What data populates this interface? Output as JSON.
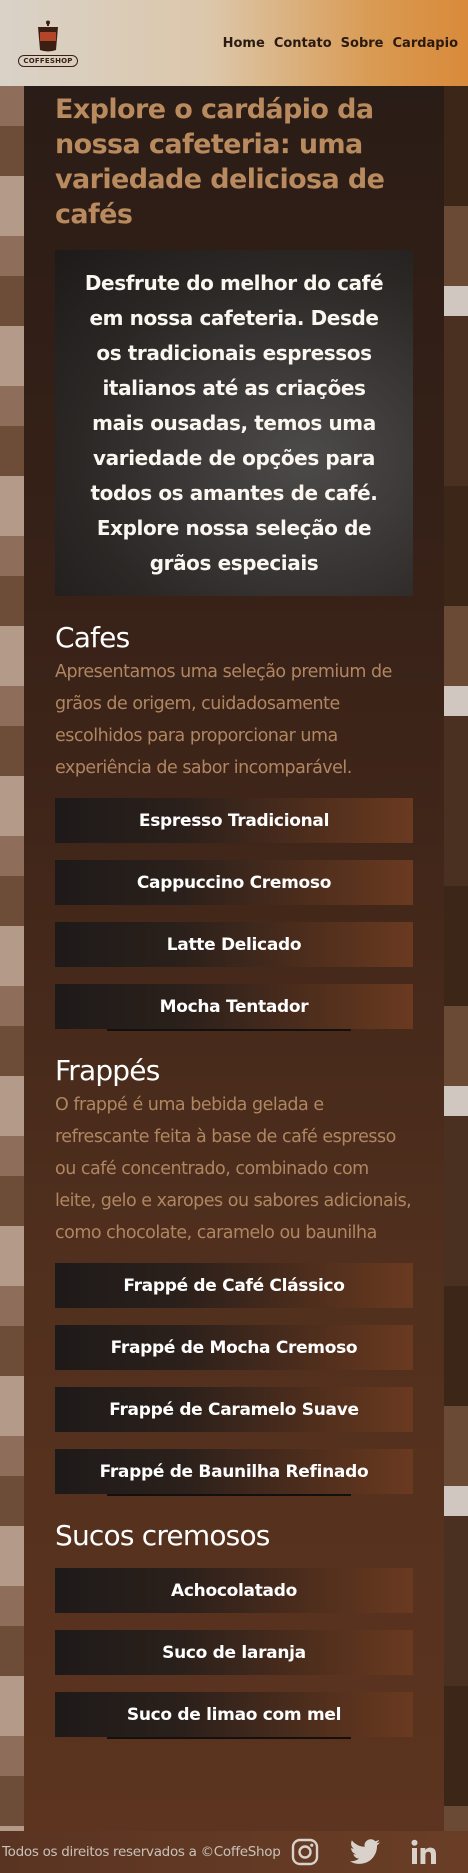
{
  "header": {
    "logo_text": "COFFESHOP",
    "nav": [
      "Home",
      "Contato",
      "Sobre",
      "Cardapio"
    ]
  },
  "hero": {
    "title": "Explore o cardápio da nossa cafeteria: uma variedade deliciosa de cafés",
    "intro": "Desfrute do melhor do café em nossa cafeteria. Desde os tradicionais espressos italianos até as criações mais ousadas, temos uma variedade de opções para todos os amantes de café. Explore nossa seleção de grãos especiais"
  },
  "sections": [
    {
      "title": "Cafes",
      "description": "Apresentamos uma seleção premium de grãos de origem, cuidadosamente escolhidos para proporcionar uma experiência de sabor incomparável.",
      "items": [
        "Espresso Tradicional",
        "Cappuccino Cremoso",
        "Latte Delicado",
        "Mocha Tentador"
      ]
    },
    {
      "title": "Frappés",
      "description": "O frappé é uma bebida gelada e refrescante feita à base de café espresso ou café concentrado, combinado com leite, gelo e xaropes ou sabores adicionais, como chocolate, caramelo ou baunilha",
      "items": [
        "Frappé de Café Clássico",
        "Frappé de Mocha Cremoso",
        "Frappé de Caramelo Suave",
        "Frappé de Baunilha Refinado"
      ]
    },
    {
      "title": "Sucos cremosos",
      "items": [
        "Achocolatado",
        "Suco de laranja",
        "Suco de limao com mel"
      ]
    }
  ],
  "footer": {
    "copyright": "Todos os direitos reservados a ©CoffeShop",
    "social_icons": [
      "instagram-icon",
      "twitter-icon",
      "linkedin-icon"
    ]
  },
  "colors": {
    "header_gradient_start": "#d9d2c8",
    "header_gradient_end": "#d98a3a",
    "hero_title": "#b88a5e",
    "section_description": "#b08661"
  }
}
